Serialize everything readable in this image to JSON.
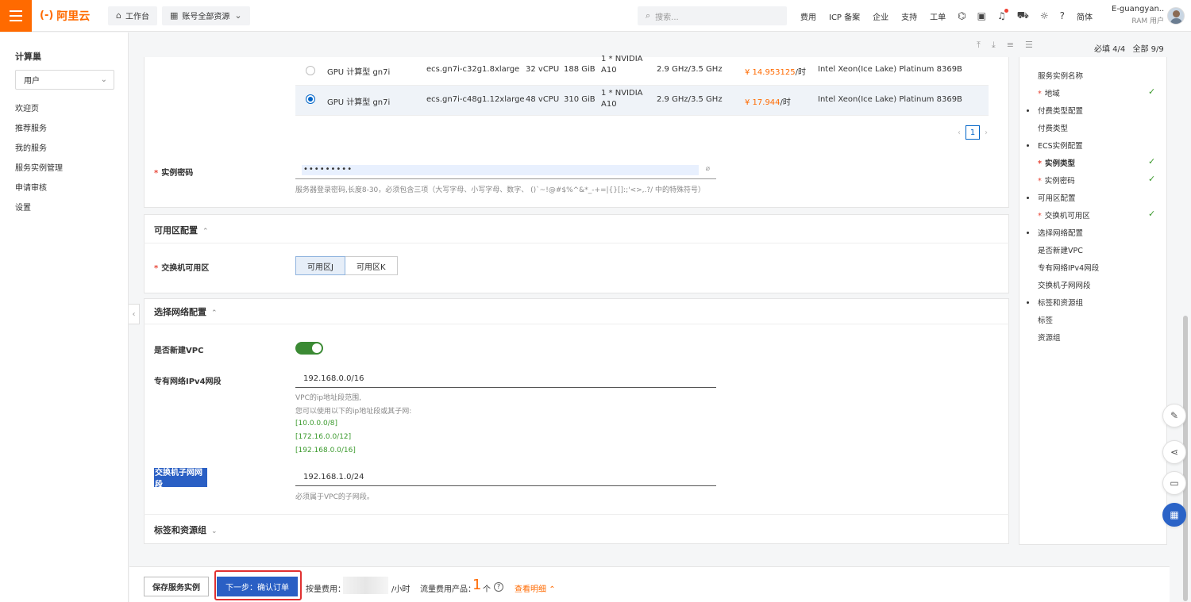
{
  "topbar": {
    "logo_mark": "(-)",
    "logo_text": "阿里云",
    "workbench": "工作台",
    "resources": "账号全部资源",
    "search_placeholder": "搜索...",
    "links": [
      "费用",
      "ICP 备案",
      "企业",
      "支持",
      "工单"
    ],
    "lang": "简体",
    "user_name": "E-guangyan...",
    "user_role": "RAM 用户"
  },
  "sidebar": {
    "title": "计算巢",
    "select_value": "用户",
    "items": [
      "欢迎页",
      "推荐服务",
      "我的服务",
      "服务实例管理",
      "申请审核",
      "设置"
    ]
  },
  "toolbar": {
    "required_count": "必填 4/4",
    "all_count": "全部 9/9"
  },
  "instances": [
    {
      "family": "GPU 计算型 gn7i",
      "spec": "ecs.gn7i-c32g1.8xlarge",
      "vcpu": "32 vCPU",
      "mem": "188 GiB",
      "gpu": "1 * NVIDIA A10",
      "freq": "2.9 GHz/3.5 GHz",
      "price": "¥ 14.953125",
      "price_unit": "/时",
      "cpu": "Intel Xeon(Ice Lake) Platinum 8369B",
      "selected": false
    },
    {
      "family": "GPU 计算型 gn7i",
      "spec": "ecs.gn7i-c48g1.12xlarge",
      "vcpu": "48 vCPU",
      "mem": "310 GiB",
      "gpu": "1 * NVIDIA A10",
      "freq": "2.9 GHz/3.5 GHz",
      "price": "¥ 17.944",
      "price_unit": "/时",
      "cpu": "Intel Xeon(Ice Lake) Platinum 8369B",
      "selected": true
    }
  ],
  "pager": {
    "current": "1"
  },
  "form": {
    "password_label": "实例密码",
    "password_value": "•••••••••",
    "password_help": "服务器登录密码,长度8-30，必须包含三项（大写字母、小写字母、数字、 ()`~!@#$%^&*_-+=|{}[]:;'<>,.?/ 中的特殊符号）",
    "zone_section": "可用区配置",
    "zone_label": "交换机可用区",
    "zone_options": [
      "可用区J",
      "可用区K"
    ],
    "network_section": "选择网络配置",
    "new_vpc_label": "是否新建VPC",
    "vpc_cidr_label": "专有网络IPv4网段",
    "vpc_cidr_value": "192.168.0.0/16",
    "vpc_help_1": "VPC的ip地址段范围,",
    "vpc_help_2": "您可以使用以下的ip地址段或其子网:",
    "vpc_ranges": [
      "[10.0.0.0/8]",
      "[172.16.0.0/12]",
      "[192.168.0.0/16]"
    ],
    "vswitch_label": "交换机子网网段",
    "vswitch_value": "192.168.1.0/24",
    "vswitch_help": "必须属于VPC的子网段。",
    "tags_section": "标签和资源组"
  },
  "right_panel": {
    "items": [
      {
        "label": "服务实例名称",
        "star": false,
        "dot": false,
        "check": false,
        "bold": false
      },
      {
        "label": "地域",
        "star": true,
        "dot": false,
        "check": true,
        "bold": false
      },
      {
        "label": "付费类型配置",
        "star": false,
        "dot": true,
        "check": false,
        "bold": false
      },
      {
        "label": "付费类型",
        "star": false,
        "dot": false,
        "check": false,
        "bold": false
      },
      {
        "label": "ECS实例配置",
        "star": false,
        "dot": true,
        "check": false,
        "bold": false
      },
      {
        "label": "实例类型",
        "star": true,
        "dot": false,
        "check": true,
        "bold": true
      },
      {
        "label": "实例密码",
        "star": true,
        "dot": false,
        "check": true,
        "bold": false
      },
      {
        "label": "可用区配置",
        "star": false,
        "dot": true,
        "check": false,
        "bold": false
      },
      {
        "label": "交换机可用区",
        "star": true,
        "dot": false,
        "check": true,
        "bold": false
      },
      {
        "label": "选择网络配置",
        "star": false,
        "dot": true,
        "check": false,
        "bold": false
      },
      {
        "label": "是否新建VPC",
        "star": false,
        "dot": false,
        "check": false,
        "bold": false
      },
      {
        "label": "专有网络IPv4网段",
        "star": false,
        "dot": false,
        "check": false,
        "bold": false
      },
      {
        "label": "交换机子网网段",
        "star": false,
        "dot": false,
        "check": false,
        "bold": false
      },
      {
        "label": "标签和资源组",
        "star": false,
        "dot": true,
        "check": false,
        "bold": false
      },
      {
        "label": "标签",
        "star": false,
        "dot": false,
        "check": false,
        "bold": false
      },
      {
        "label": "资源组",
        "star": false,
        "dot": false,
        "check": false,
        "bold": false
      }
    ]
  },
  "footer": {
    "save": "保存服务实例",
    "next": "下一步：确认订单",
    "fee_label": "按量费用：",
    "fee_unit": "/小时",
    "traffic_label": "流量费用产品：",
    "traffic_count": "1",
    "traffic_unit": "个",
    "detail": "查看明细"
  },
  "colors": {
    "brand": "#ff6a00",
    "primary": "#2a5fc4",
    "success": "#3b9a2d"
  }
}
